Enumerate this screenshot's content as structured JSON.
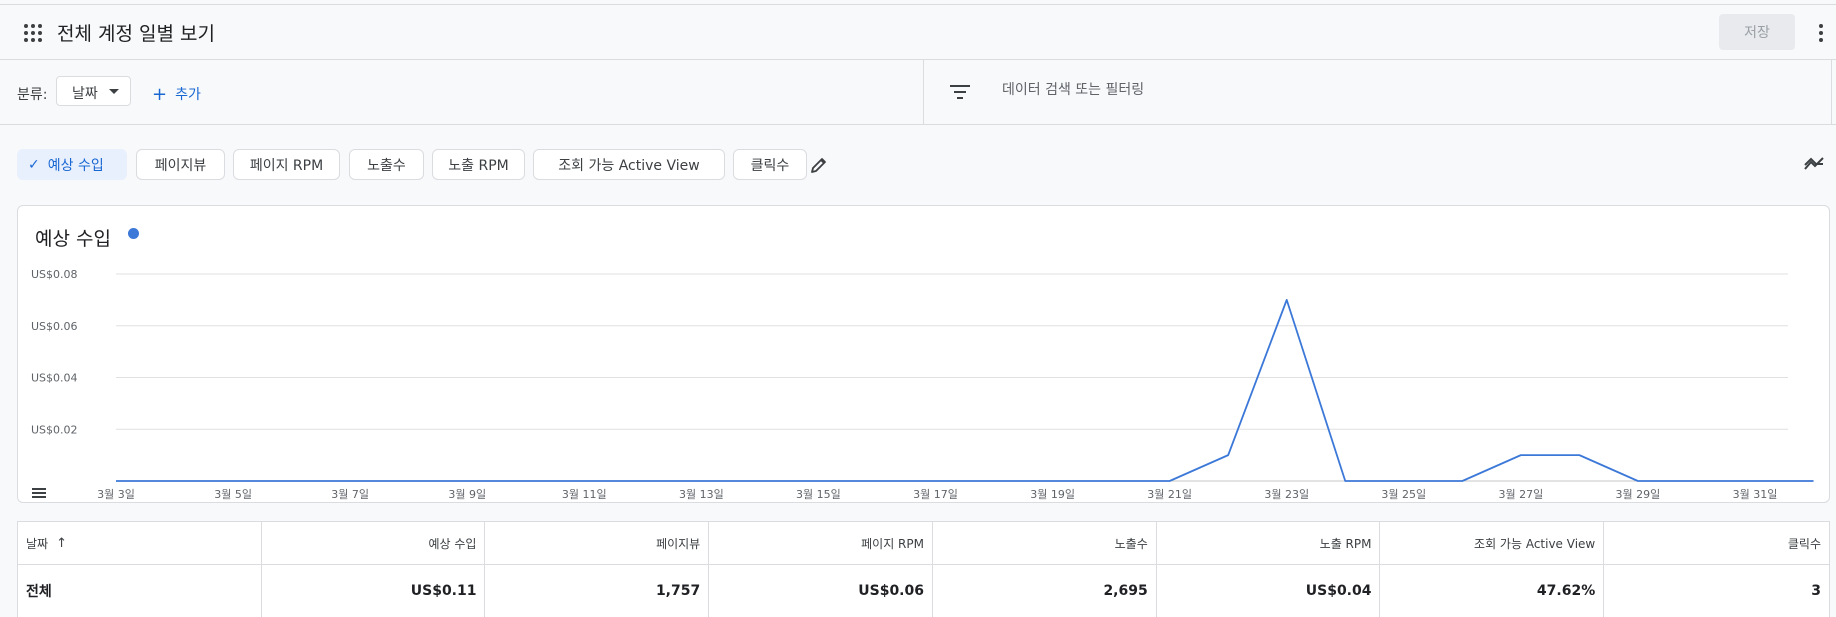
{
  "header": {
    "title": "전체 계정 일별 보기",
    "save_label": "저장"
  },
  "toolbar": {
    "category_label": "분류:",
    "category_value": "날짜",
    "add_label": "추가",
    "search_placeholder": "데이터 검색 또는 필터링"
  },
  "metric_chips": [
    {
      "label": "예상 수입",
      "selected": true
    },
    {
      "label": "페이지뷰",
      "selected": false
    },
    {
      "label": "페이지 RPM",
      "selected": false
    },
    {
      "label": "노출수",
      "selected": false
    },
    {
      "label": "노출 RPM",
      "selected": false
    },
    {
      "label": "조회 가능 Active View",
      "selected": false
    },
    {
      "label": "클릭수",
      "selected": false
    }
  ],
  "chart_data": {
    "type": "line",
    "title": "예상 수입",
    "y_ticks": [
      "US$0.02",
      "US$0.04",
      "US$0.06",
      "US$0.08"
    ],
    "ylim": [
      0,
      0.08
    ],
    "x_ticks": [
      "3월 3일",
      "3월 5일",
      "3월 7일",
      "3월 9일",
      "3월 11일",
      "3월 13일",
      "3월 15일",
      "3월 17일",
      "3월 19일",
      "3월 21일",
      "3월 23일",
      "3월 25일",
      "3월 27일",
      "3월 29일",
      "3월 31일"
    ],
    "x_days": [
      3,
      4,
      5,
      6,
      7,
      8,
      9,
      10,
      11,
      12,
      13,
      14,
      15,
      16,
      17,
      18,
      19,
      20,
      21,
      22,
      23,
      24,
      25,
      26,
      27,
      28,
      29,
      30,
      31,
      32
    ],
    "series": [
      {
        "color": "#3c78d8",
        "values": [
          0,
          0,
          0,
          0,
          0,
          0,
          0,
          0,
          0,
          0,
          0,
          0,
          0,
          0,
          0,
          0,
          0,
          0,
          0,
          0.01,
          0.07,
          0,
          0,
          0,
          0.01,
          0.01,
          0,
          0,
          0,
          0
        ]
      }
    ],
    "grid": true
  },
  "table": {
    "columns": [
      "날짜",
      "예상 수입",
      "페이지뷰",
      "페이지 RPM",
      "노출수",
      "노출 RPM",
      "조회 가능 Active View",
      "클릭수"
    ],
    "total_row": [
      "전체",
      "US$0.11",
      "1,757",
      "US$0.06",
      "2,695",
      "US$0.04",
      "47.62%",
      "3"
    ]
  }
}
